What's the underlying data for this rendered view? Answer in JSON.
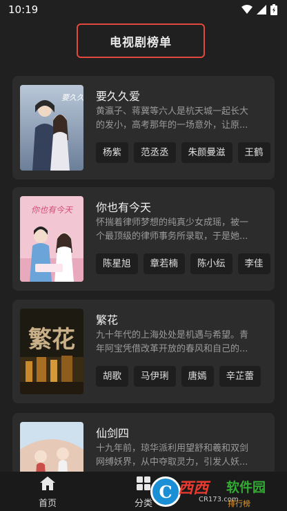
{
  "status": {
    "time": "10:19"
  },
  "header": {
    "title": "电视剧榜单"
  },
  "cards": [
    {
      "title": "要久久爱",
      "desc_line1": "黄瀛子、蒋冀等六人是杭天城一起长大",
      "desc_line2": "的发小，高考那年的一场意外，让原...",
      "cast": [
        "杨紫",
        "范丞丞",
        "朱颜曼滋",
        "王鹤"
      ],
      "poster_text": "要久久爱"
    },
    {
      "title": "你也有今天",
      "desc_line1": "怀揣着律师梦想的纯真少女成瑶，被一",
      "desc_line2": "个最顶级的律师事务所录取，于是她...",
      "cast": [
        "陈星旭",
        "章若楠",
        "陈小纭",
        "李佳"
      ],
      "poster_text": "你也有今天"
    },
    {
      "title": "繁花",
      "desc_line1": "九十年代的上海处处是机遇与希望。青",
      "desc_line2": "年阿宝凭借改革开放的春风和自己的...",
      "cast": [
        "胡歌",
        "马伊琍",
        "唐嫣",
        "辛芷蕾"
      ],
      "poster_text": "繁花"
    },
    {
      "title": "仙剑四",
      "desc_line1": "十九年前，琼华派利用望舒和羲和双剑",
      "desc_line2": "网缚妖界，从中夺取灵力，引发人妖...",
      "cast": [],
      "poster_text": ""
    }
  ],
  "nav": {
    "home_label": "首页",
    "category_label": "分类"
  },
  "watermark": {
    "brand": "西西",
    "soft": "软件园",
    "site": "CR173.com",
    "extra": "排行榜"
  }
}
